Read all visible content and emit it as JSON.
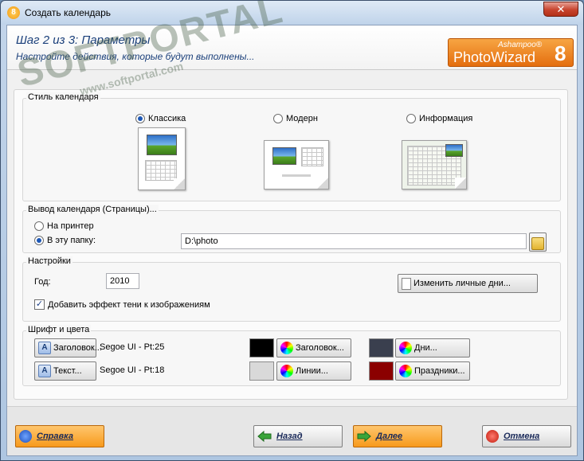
{
  "window": {
    "title": "Создать календарь",
    "app_icon_glyph": "8",
    "close_glyph": "✕"
  },
  "header": {
    "step_title": "Шаг 2 из 3: Параметры",
    "step_subtitle": "Настройте действия, которые будут выполнены...",
    "logo_brand": "Ashampoo®",
    "logo_name": "PhotoWizard",
    "logo_version": "8"
  },
  "watermark": {
    "big": "SOFTPORTAL",
    "small": "www.softportal.com"
  },
  "calendar_style": {
    "label": "Стиль календаря",
    "options": [
      {
        "label": "Классика",
        "selected": true
      },
      {
        "label": "Модерн",
        "selected": false
      },
      {
        "label": "Информация",
        "selected": false
      }
    ]
  },
  "output": {
    "label": "Вывод календаря (Страницы)...",
    "printer_label": "На принтер",
    "printer_selected": false,
    "folder_label": "В эту папку:",
    "folder_selected": true,
    "folder_path": "D:\\photo",
    "browse_icon": "folder-icon"
  },
  "settings": {
    "label": "Настройки",
    "year_label": "Год:",
    "year_value": "2010",
    "personal_days_button": "Изменить личные дни...",
    "shadow_checkbox_label": "Добавить эффект тени к изображениям",
    "shadow_checked": true,
    "check_glyph": "✓"
  },
  "fonts": {
    "label": "Шрифт и цвета",
    "header_font_button": "Заголовок...",
    "header_font_value": "Segoe UI - Pt:25",
    "text_font_button": "Текст...",
    "text_font_value": "Segoe UI - Pt:18",
    "font_icon_glyph": "A",
    "header_color_button": "Заголовок...",
    "header_color": "#000000",
    "lines_color_button": "Линии...",
    "lines_color": "#d9d9d9",
    "days_color_button": "Дни...",
    "days_color": "#3a3f4e",
    "holidays_color_button": "Праздники...",
    "holidays_color": "#8b0000"
  },
  "footer": {
    "help": "Справка",
    "back": "Назад",
    "next": "Далее",
    "cancel": "Отмена"
  }
}
